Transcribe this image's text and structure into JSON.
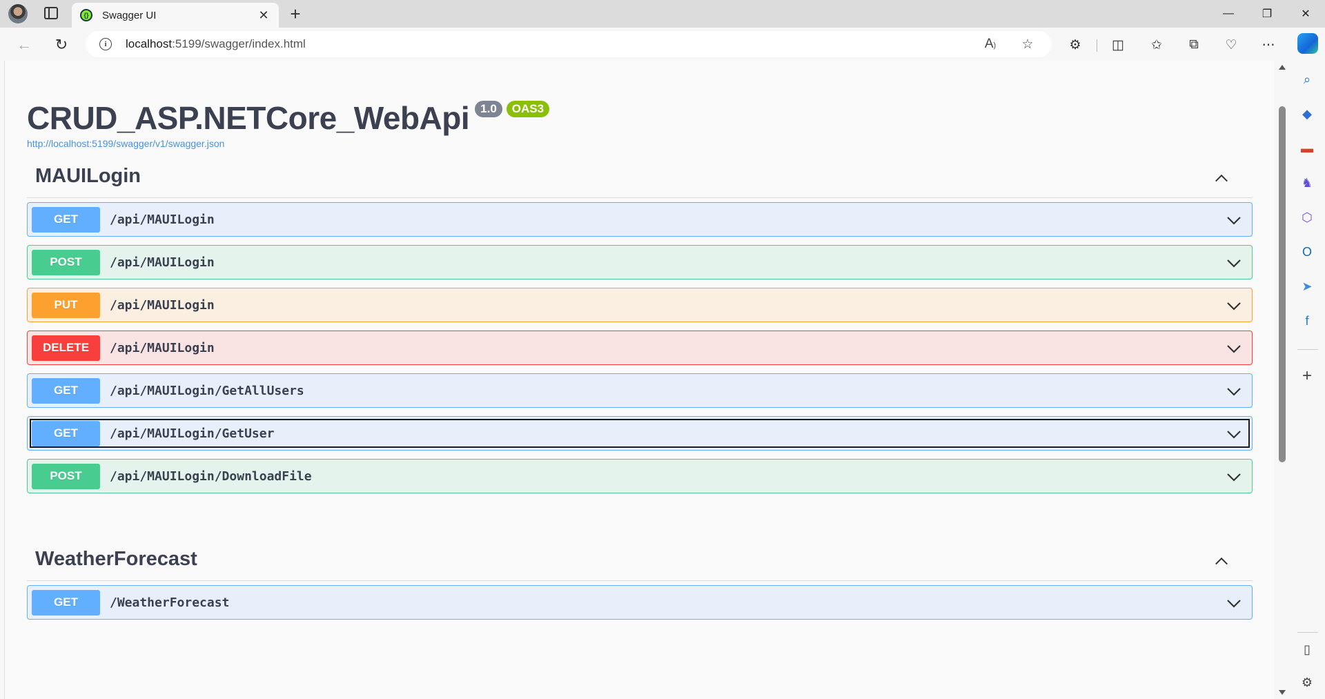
{
  "browser": {
    "tab_title": "Swagger UI",
    "url_host": "localhost",
    "url_rest": ":5199/swagger/index.html",
    "window_controls": {
      "minimize": "—",
      "restore": "❐",
      "close": "✕"
    }
  },
  "api": {
    "title": "CRUD_ASP.NETCore_WebApi",
    "version": "1.0",
    "oas": "OAS3",
    "spec_url": "http://localhost:5199/swagger/v1/swagger.json"
  },
  "sections": [
    {
      "name": "MAUILogin",
      "operations": [
        {
          "method": "GET",
          "path": "/api/MAUILogin"
        },
        {
          "method": "POST",
          "path": "/api/MAUILogin"
        },
        {
          "method": "PUT",
          "path": "/api/MAUILogin"
        },
        {
          "method": "DELETE",
          "path": "/api/MAUILogin"
        },
        {
          "method": "GET",
          "path": "/api/MAUILogin/GetAllUsers"
        },
        {
          "method": "GET",
          "path": "/api/MAUILogin/GetUser"
        },
        {
          "method": "POST",
          "path": "/api/MAUILogin/DownloadFile"
        }
      ]
    },
    {
      "name": "WeatherForecast",
      "operations": [
        {
          "method": "GET",
          "path": "/WeatherForecast"
        }
      ]
    }
  ],
  "colors": {
    "get": "#61affe",
    "post": "#49cc90",
    "put": "#fca130",
    "delete": "#f93e3e",
    "title": "#3b4151",
    "link": "#4990e2",
    "oas_badge": "#89bf04",
    "version_badge": "#7d8492"
  }
}
